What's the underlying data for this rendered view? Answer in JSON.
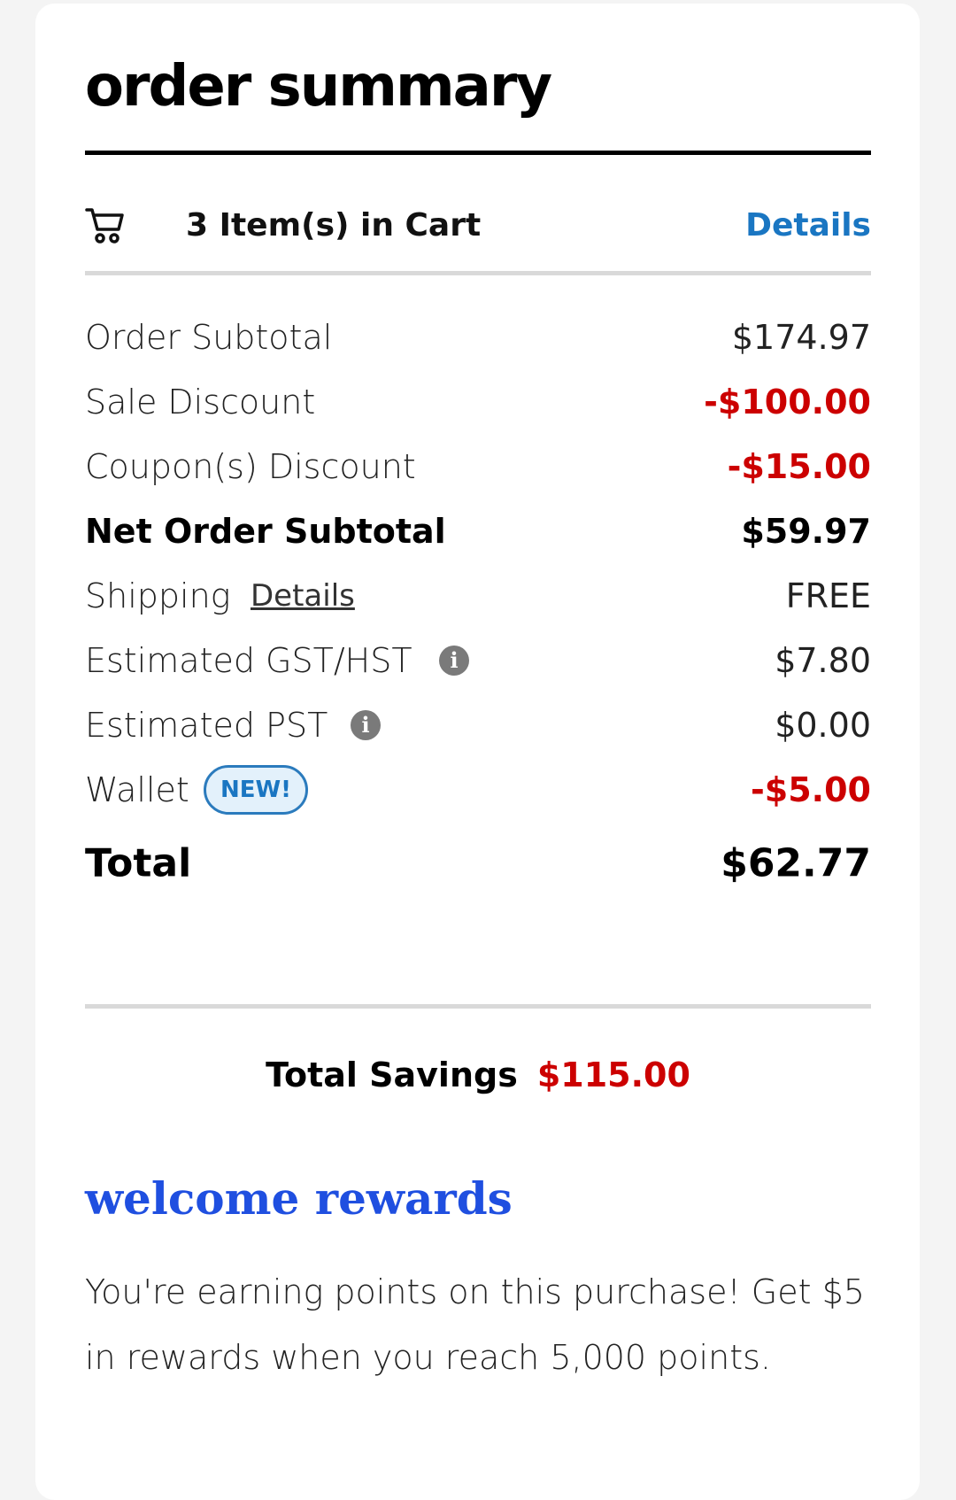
{
  "summary": {
    "title": "order summary"
  },
  "cart": {
    "icon": "shopping-cart-icon",
    "label": "3 Item(s) in Cart",
    "details_label": "Details"
  },
  "lines": {
    "order_subtotal": {
      "label": "Order Subtotal",
      "value": "$174.97"
    },
    "sale_discount": {
      "label": "Sale Discount",
      "value": "-$100.00"
    },
    "coupon_discount": {
      "label": "Coupon(s) Discount",
      "value": "-$15.00"
    },
    "net_subtotal": {
      "label": "Net Order Subtotal",
      "value": "$59.97"
    },
    "shipping": {
      "label": "Shipping",
      "link": "Details",
      "value": "FREE"
    },
    "gst_hst": {
      "label": "Estimated GST/HST",
      "info_icon": "info-icon",
      "value": "$7.80"
    },
    "pst": {
      "label": "Estimated PST",
      "info_icon": "info-icon",
      "value": "$0.00"
    },
    "wallet": {
      "label": "Wallet",
      "badge": "NEW!",
      "value": "-$5.00"
    }
  },
  "total": {
    "label": "Total",
    "value": "$62.77"
  },
  "savings": {
    "label": "Total Savings",
    "value": "$115.00"
  },
  "rewards": {
    "title": "welcome rewards",
    "text": "You're earning points on this purchase! Get $5 in rewards when you reach 5,000 points."
  },
  "colors": {
    "accent_blue": "#1a76c2",
    "rewards_blue": "#1f4fe0",
    "discount_red": "#cc0000",
    "badge_bg": "#e3f1fb"
  }
}
